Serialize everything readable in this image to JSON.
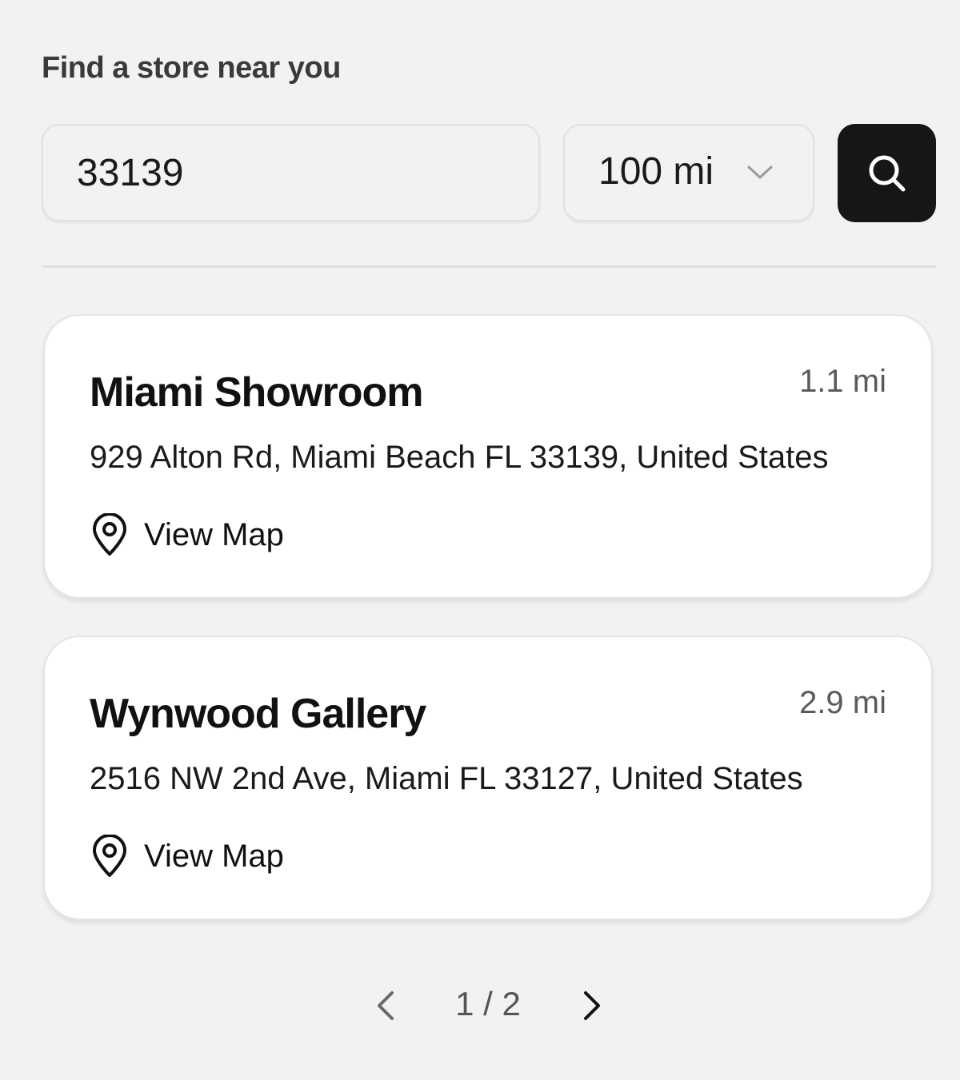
{
  "header": {
    "title": "Find a store near you"
  },
  "search": {
    "zip_value": "33139",
    "radius_value": "100 mi",
    "chevron_icon": "chevron-down-icon",
    "search_icon": "search-icon",
    "button_color": "#161616"
  },
  "stores": [
    {
      "name": "Miami Showroom",
      "distance": "1.1 mi",
      "address": "929 Alton Rd, Miami Beach FL 33139, United States",
      "map_label": "View Map",
      "map_icon": "map-pin-icon"
    },
    {
      "name": "Wynwood Gallery",
      "distance": "2.9 mi",
      "address": "2516 NW 2nd Ave, Miami FL 33127, United States",
      "map_label": "View Map",
      "map_icon": "map-pin-icon"
    }
  ],
  "pagination": {
    "indicator": "1 / 2",
    "prev_icon": "chevron-left-icon",
    "next_icon": "chevron-right-icon"
  }
}
